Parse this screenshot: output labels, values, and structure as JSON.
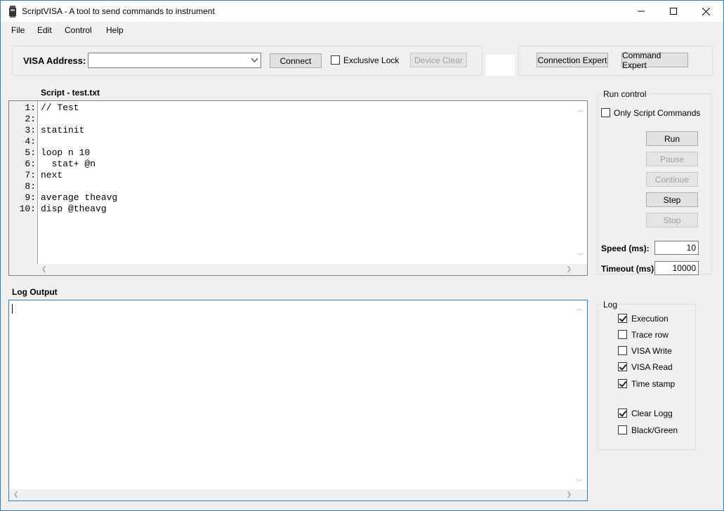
{
  "window": {
    "title": "ScriptVISA - A tool to send commands to instrument"
  },
  "menu": [
    "File",
    "Edit",
    "Control",
    "Help"
  ],
  "connection": {
    "visa_label": "VISA Address:",
    "visa_value": "",
    "connect": "Connect",
    "exclusive_lock": "Exclusive Lock",
    "exclusive_lock_checked": false,
    "device_clear": "Device Clear",
    "connection_expert": "Connection Expert",
    "command_expert": "Command Expert"
  },
  "script": {
    "title": "Script - test.txt",
    "line_numbers": [
      "1:",
      "2:",
      "3:",
      "4:",
      "5:",
      "6:",
      "7:",
      "8:",
      "9:",
      "10:"
    ],
    "lines": [
      "// Test",
      "",
      "statinit",
      "",
      "loop n 10",
      "  stat+ @n",
      "next",
      "",
      "average theavg",
      "disp @theavg"
    ]
  },
  "run_control": {
    "title": "Run control",
    "only_script": "Only Script Commands",
    "only_script_checked": false,
    "run": "Run",
    "pause": "Pause",
    "continue": "Continue",
    "step": "Step",
    "stop": "Stop",
    "speed_label": "Speed (ms):",
    "speed_value": "10",
    "timeout_label": "Timeout (ms):",
    "timeout_value": "10000"
  },
  "log_output": {
    "title": "Log Output",
    "content": ""
  },
  "log": {
    "title": "Log",
    "execution": "Execution",
    "trace_row": "Trace row",
    "visa_write": "VISA Write",
    "visa_read": "VISA Read",
    "time_stamp": "Time stamp",
    "clear_logg": "Clear Logg",
    "black_green": "Black/Green"
  }
}
